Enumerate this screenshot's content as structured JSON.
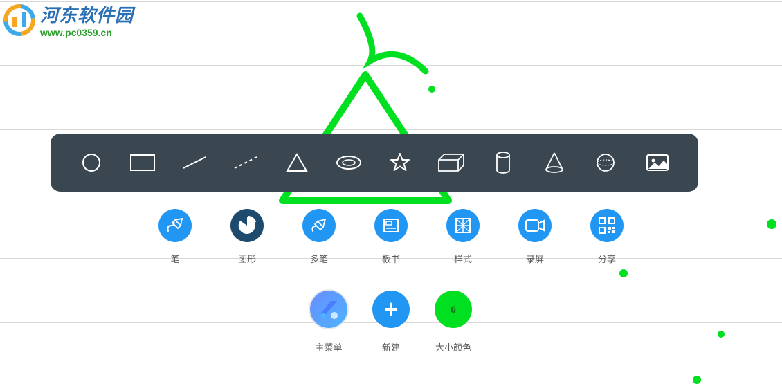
{
  "watermark": {
    "title": "河东软件园",
    "url": "www.pc0359.cn"
  },
  "shapes": {
    "circle": "circle-shape",
    "rectangle": "rectangle-shape",
    "line": "line-shape",
    "dashed_line": "dashed-line-shape",
    "triangle": "triangle-shape",
    "ellipse": "ellipse-shape",
    "star": "star-shape",
    "cuboid": "cuboid-shape",
    "cylinder": "cylinder-shape",
    "cone": "cone-shape",
    "sphere": "sphere-shape",
    "image": "image-shape"
  },
  "tools": {
    "pen": {
      "label": "笔"
    },
    "shape": {
      "label": "图形"
    },
    "multipen": {
      "label": "多笔"
    },
    "template": {
      "label": "板书"
    },
    "style": {
      "label": "样式"
    },
    "record": {
      "label": "录屏"
    },
    "share": {
      "label": "分享"
    }
  },
  "bottom": {
    "menu": {
      "label": "主菜单"
    },
    "new": {
      "label": "新建"
    },
    "color": {
      "label": "大小颜色",
      "value": "6"
    }
  },
  "colors": {
    "accent": "#2196f3",
    "accent_dark": "#1e4a6d",
    "bar_bg": "#3b4750",
    "stroke": "#00e020"
  }
}
